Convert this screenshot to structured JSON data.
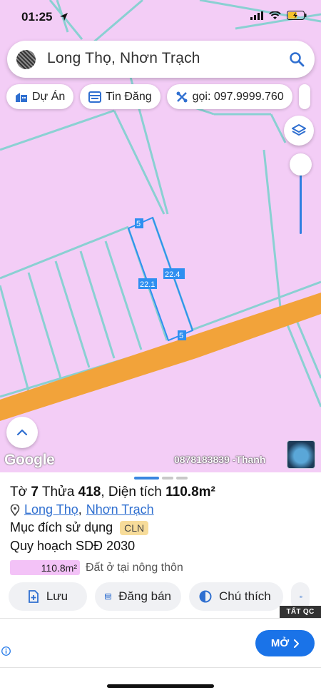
{
  "status": {
    "time": "01:25"
  },
  "search": {
    "query": "Long Thọ, Nhơn Trạch"
  },
  "chips": [
    {
      "label": "Dự Án",
      "icon": "building-icon"
    },
    {
      "label": "Tin Đăng",
      "icon": "listing-icon"
    },
    {
      "label": "gọi: 097.9999.760",
      "icon": "crossed-tools-icon"
    }
  ],
  "map": {
    "parcel_top": "5",
    "parcel_bottom": "5",
    "parcel_left": "22.1",
    "parcel_right": "22.4",
    "google": "Google",
    "contact": "0878183839 -Thanh"
  },
  "colors": {
    "land": "#f3cdf6",
    "road": "#f2a33a",
    "boundary": "#7fd1cf",
    "parcel": "#2f8ff0",
    "accent": "#1a73e8"
  },
  "sheet": {
    "to_label": "Tờ",
    "to": "7",
    "thua_label": "Thửa",
    "thua": "418",
    "dientich_label": "Diện tích",
    "area": "110.8m²",
    "loc1": "Long Thọ",
    "sep": ",",
    "loc2": "Nhơn Trạch",
    "purpose_label": "Mục đích sử dụng",
    "purpose_code": "CLN",
    "plan_label": "Quy hoạch SDĐ 2030",
    "plan_area": "110.8m²",
    "plan_use": "Đất ở tại nông thôn"
  },
  "actions": [
    {
      "label": "Lưu"
    },
    {
      "label": "Đăng bán"
    },
    {
      "label": "Chú thích"
    }
  ],
  "ad": {
    "tag": "TẤT QC",
    "button": "MỞ"
  }
}
